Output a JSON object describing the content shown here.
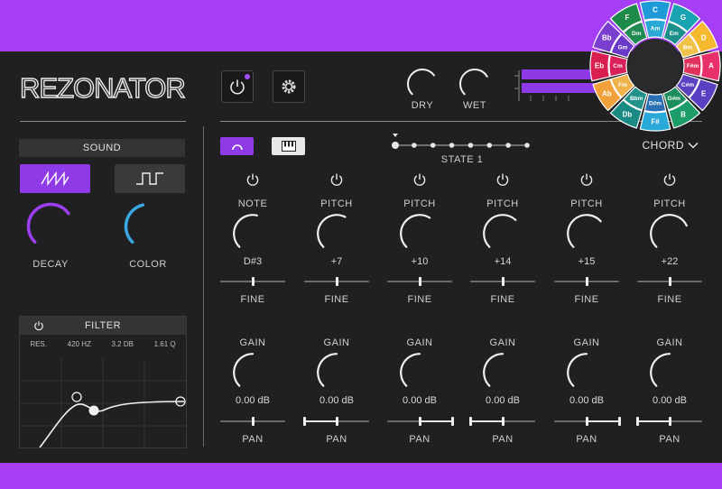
{
  "brand": {
    "logo_text": "REZONATOR"
  },
  "mix": {
    "dry_label": "DRY",
    "wet_label": "WET",
    "dry_level": 0.7,
    "wet_level": 0.72
  },
  "sound": {
    "header": "SOUND",
    "decay_label": "DECAY",
    "color_label": "COLOR",
    "decay_level": 0.7,
    "color_level": 0.45,
    "wave_options": [
      "saw-wave-icon",
      "square-wave-icon"
    ],
    "selected_wave": 0
  },
  "filter": {
    "header": "FILTER",
    "params": [
      "RES.",
      "420 HZ",
      "3.2 DB",
      "1.61 Q"
    ]
  },
  "state": {
    "label": "STATE 1",
    "steps": 8,
    "current": 1
  },
  "chord_label": "CHORD",
  "voices": [
    {
      "top_label": "NOTE",
      "top_value": "D#3",
      "top_level": 0.55,
      "fine_label": "FINE",
      "fine": 0.5,
      "gain_label": "GAIN",
      "gain_value": "0.00 dB",
      "gain_level": 0.5,
      "pan_label": "PAN",
      "pan_from": 0.5,
      "pan_to": 0.5
    },
    {
      "top_label": "PITCH",
      "top_value": "+7",
      "top_level": 0.6,
      "fine_label": "FINE",
      "fine": 0.5,
      "gain_label": "GAIN",
      "gain_value": "0.00 dB",
      "gain_level": 0.5,
      "pan_label": "PAN",
      "pan_from": 0.0,
      "pan_to": 0.5
    },
    {
      "top_label": "PITCH",
      "top_value": "+10",
      "top_level": 0.62,
      "fine_label": "FINE",
      "fine": 0.5,
      "gain_label": "GAIN",
      "gain_value": "0.00 dB",
      "gain_level": 0.5,
      "pan_label": "PAN",
      "pan_from": 0.5,
      "pan_to": 1.0
    },
    {
      "top_label": "PITCH",
      "top_value": "+14",
      "top_level": 0.66,
      "fine_label": "FINE",
      "fine": 0.5,
      "gain_label": "GAIN",
      "gain_value": "0.00 dB",
      "gain_level": 0.5,
      "pan_label": "PAN",
      "pan_from": 0.0,
      "pan_to": 0.5
    },
    {
      "top_label": "PITCH",
      "top_value": "+15",
      "top_level": 0.68,
      "fine_label": "FINE",
      "fine": 0.5,
      "gain_label": "GAIN",
      "gain_value": "0.00 dB",
      "gain_level": 0.5,
      "pan_label": "PAN",
      "pan_from": 0.5,
      "pan_to": 1.0
    },
    {
      "top_label": "PITCH",
      "top_value": "+22",
      "top_level": 0.74,
      "fine_label": "FINE",
      "fine": 0.5,
      "gain_label": "GAIN",
      "gain_value": "0.00 dB",
      "gain_level": 0.5,
      "pan_label": "PAN",
      "pan_from": 0.0,
      "pan_to": 0.5
    }
  ],
  "chord_wheel": {
    "outer": [
      {
        "label": "C",
        "color": "#1e9bd6"
      },
      {
        "label": "G",
        "color": "#1aa3b0"
      },
      {
        "label": "D",
        "color": "#f5b82e"
      },
      {
        "label": "A",
        "color": "#e8306a"
      },
      {
        "label": "E",
        "color": "#5b3fc2"
      },
      {
        "label": "B",
        "color": "#1c9d6a"
      },
      {
        "label": "F#",
        "color": "#29a9d8"
      },
      {
        "label": "Db",
        "color": "#1b8a85"
      },
      {
        "label": "Ab",
        "color": "#f2a03a"
      },
      {
        "label": "Eb",
        "color": "#d81f4f"
      },
      {
        "label": "Bb",
        "color": "#7a3fcf"
      },
      {
        "label": "F",
        "color": "#1e8a4a"
      }
    ],
    "inner": [
      {
        "label": "Am",
        "color": "#2aa9d6"
      },
      {
        "label": "Em",
        "color": "#1b8f8a"
      },
      {
        "label": "Bm",
        "color": "#f0c248"
      },
      {
        "label": "F#m",
        "color": "#e0305c"
      },
      {
        "label": "C#m",
        "color": "#5a42c0"
      },
      {
        "label": "G#m",
        "color": "#1e8e5e"
      },
      {
        "label": "D#m",
        "color": "#2a6fb3"
      },
      {
        "label": "Bbm",
        "color": "#22938a"
      },
      {
        "label": "Fm",
        "color": "#f0b24a"
      },
      {
        "label": "Cm",
        "color": "#d9205a"
      },
      {
        "label": "Gm",
        "color": "#6a3ac8"
      },
      {
        "label": "Dm",
        "color": "#1f8a52"
      }
    ],
    "center_color": "#2a2a2c"
  }
}
